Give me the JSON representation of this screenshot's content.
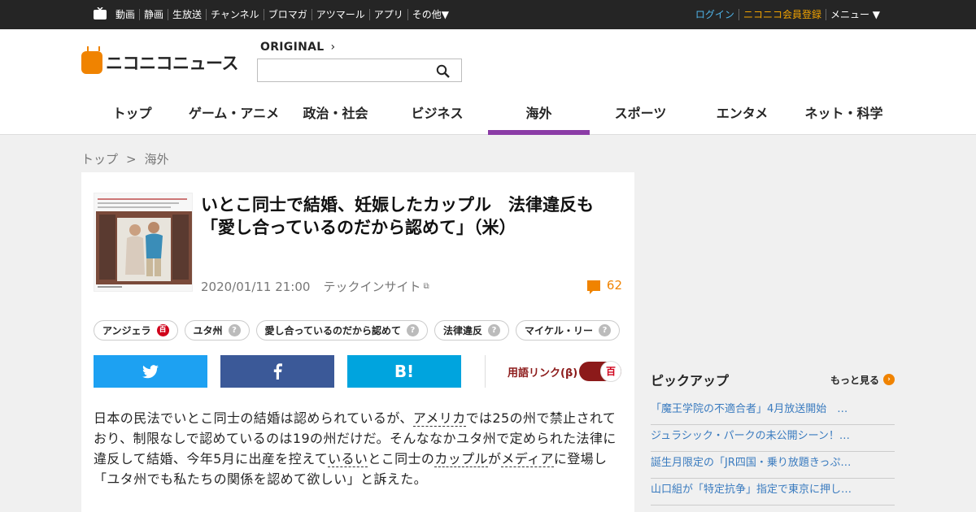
{
  "topbar": {
    "nav": [
      "動画",
      "静画",
      "生放送",
      "チャンネル",
      "ブロマガ",
      "アツマール",
      "アプリ",
      "その他▼"
    ],
    "login": "ログイン",
    "register": "ニコニコ会員登録",
    "menu": "メニュー ▼"
  },
  "header": {
    "logo_text": "ニコニコニュース",
    "original_label": "ORIGINAL",
    "original_chevron": "›",
    "search": {
      "value": "",
      "placeholder": ""
    },
    "nav": [
      {
        "label": "トップ",
        "active": false
      },
      {
        "label": "ゲーム・アニメ",
        "active": false
      },
      {
        "label": "政治・社会",
        "active": false
      },
      {
        "label": "ビジネス",
        "active": false
      },
      {
        "label": "海外",
        "active": true
      },
      {
        "label": "スポーツ",
        "active": false
      },
      {
        "label": "エンタメ",
        "active": false
      },
      {
        "label": "ネット・科学",
        "active": false
      }
    ]
  },
  "breadcrumb": {
    "home": "トップ",
    "sep": ">",
    "current": "海外"
  },
  "article": {
    "title": "いとこ同士で結婚、妊娠したカップル　法律違反も「愛し合っているのだから認めて」（米）",
    "date": "2020/01/11 21:00",
    "source": "テックインサイト",
    "comment_count": "62",
    "tags": [
      {
        "label": "アンジェラ",
        "badge": "百"
      },
      {
        "label": "ユタ州",
        "badge": "?"
      },
      {
        "label": "愛し合っているのだから認めて",
        "badge": "?"
      },
      {
        "label": "法律違反",
        "badge": "?"
      },
      {
        "label": "マイケル・リー",
        "badge": "?"
      }
    ],
    "share": {
      "hatena": "B!"
    },
    "term_link_label": "用語リンク(β)",
    "term_toggle_icon": "百",
    "body": {
      "p1": "日本の民法でいとこ同士の結婚は認められているが、",
      "link1": "アメリカ",
      "p2": "では25の州で禁止されており、制限なしで認めているのは19の州だけだ。そんななかユタ州で定められた法律に違反して結婚、今年5月に出産を控えて",
      "link2": "いるい",
      "p3": "とこ同士の",
      "link3": "カップル",
      "p4": "が",
      "link4": "メディア",
      "p5": "に登場し「ユタ州でも私たちの関係を認めて欲しい」と訴えた。"
    }
  },
  "pickup": {
    "title": "ピックアップ",
    "more": "もっと見る",
    "items": [
      "「魔王学院の不適合者」4月放送開始　…",
      "ジュラシック・パークの未公開シーン！…",
      "誕生月限定の「JR四国・乗り放題きっぷ…",
      "山口組が「特定抗争」指定で東京に押し…"
    ]
  },
  "colors": {
    "accent": "#8b3ca6",
    "brand": "#f08300",
    "twitter": "#1da1f2",
    "facebook": "#3b5998",
    "hatena": "#00a4de"
  }
}
